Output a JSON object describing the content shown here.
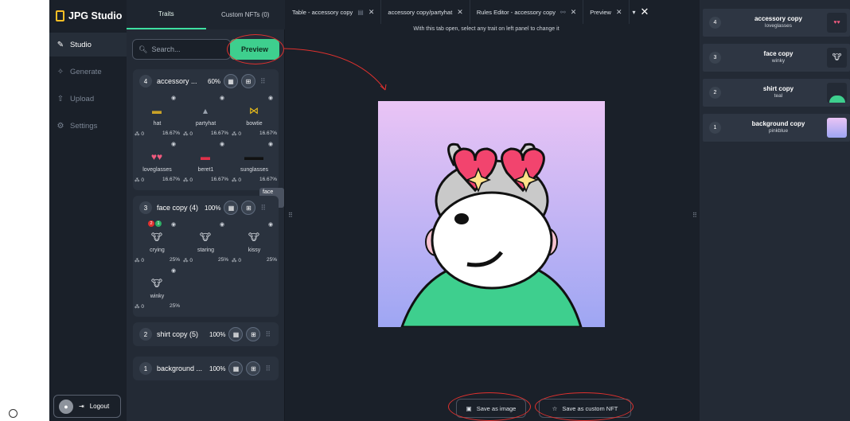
{
  "app": {
    "brand": "JPG Studio"
  },
  "nav": {
    "items": [
      {
        "label": "Studio"
      },
      {
        "label": "Generate"
      },
      {
        "label": "Upload"
      },
      {
        "label": "Settings"
      }
    ],
    "logout": "Logout"
  },
  "traits_panel": {
    "tabs": [
      "Traits",
      "Custom NFTs (0)"
    ],
    "search_placeholder": "Search...",
    "preview_label": "Preview",
    "tooltip": "face copy table",
    "groups": [
      {
        "num": "4",
        "name": "accessory ...",
        "pct": "60%",
        "traits": [
          {
            "label": "hat",
            "count": "0",
            "pct": "16.67%"
          },
          {
            "label": "partyhat",
            "count": "0",
            "pct": "16.67%"
          },
          {
            "label": "bowtie",
            "count": "0",
            "pct": "16.67%"
          },
          {
            "label": "loveglasses",
            "count": "0",
            "pct": "16.67%"
          },
          {
            "label": "beret1",
            "count": "0",
            "pct": "16.67%"
          },
          {
            "label": "sunglasses",
            "count": "0",
            "pct": "16.67%"
          }
        ]
      },
      {
        "num": "3",
        "name": "face copy (4)",
        "pct": "100%",
        "badges": [
          "2",
          "1"
        ],
        "traits": [
          {
            "label": "crying",
            "count": "0",
            "pct": "25%"
          },
          {
            "label": "staring",
            "count": "0",
            "pct": "25%"
          },
          {
            "label": "kissy",
            "count": "0",
            "pct": "25%"
          },
          {
            "label": "winky",
            "count": "0",
            "pct": "25%"
          }
        ]
      },
      {
        "num": "2",
        "name": "shirt copy (5)",
        "pct": "100%"
      },
      {
        "num": "1",
        "name": "background ...",
        "pct": "100%"
      }
    ]
  },
  "main": {
    "tabs": [
      {
        "label": "Table - accessory copy"
      },
      {
        "label": "accessory copy/partyhat"
      },
      {
        "label": "Rules Editor - accessory copy"
      },
      {
        "label": "Preview"
      }
    ],
    "hint": "With this tab open, select any trait on left panel to change it",
    "save_image": "Save as image",
    "save_nft": "Save as custom NFT"
  },
  "layers": [
    {
      "num": "4",
      "name": "accessory copy",
      "value": "loveglasses"
    },
    {
      "num": "3",
      "name": "face copy",
      "value": "winky"
    },
    {
      "num": "2",
      "name": "shirt copy",
      "value": "teal"
    },
    {
      "num": "1",
      "name": "background copy",
      "value": "pinkblue"
    }
  ],
  "colors": {
    "accent": "#3ecf8e",
    "annotation": "#e0312e",
    "brand": "#fbbf24"
  }
}
